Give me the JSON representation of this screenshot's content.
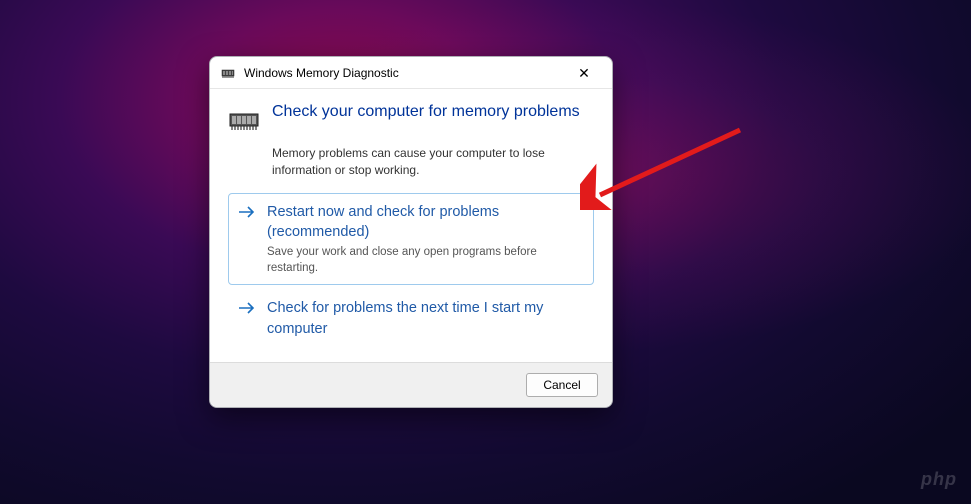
{
  "titlebar": {
    "title": "Windows Memory Diagnostic",
    "close_symbol": "✕"
  },
  "heading": "Check your computer for memory problems",
  "subtext": "Memory problems can cause your computer to lose information or stop working.",
  "options": [
    {
      "title": "Restart now and check for problems (recommended)",
      "desc": "Save your work and close any open programs before restarting."
    },
    {
      "title": "Check for problems the next time I start my computer",
      "desc": ""
    }
  ],
  "footer": {
    "cancel_label": "Cancel"
  },
  "watermark": "php"
}
